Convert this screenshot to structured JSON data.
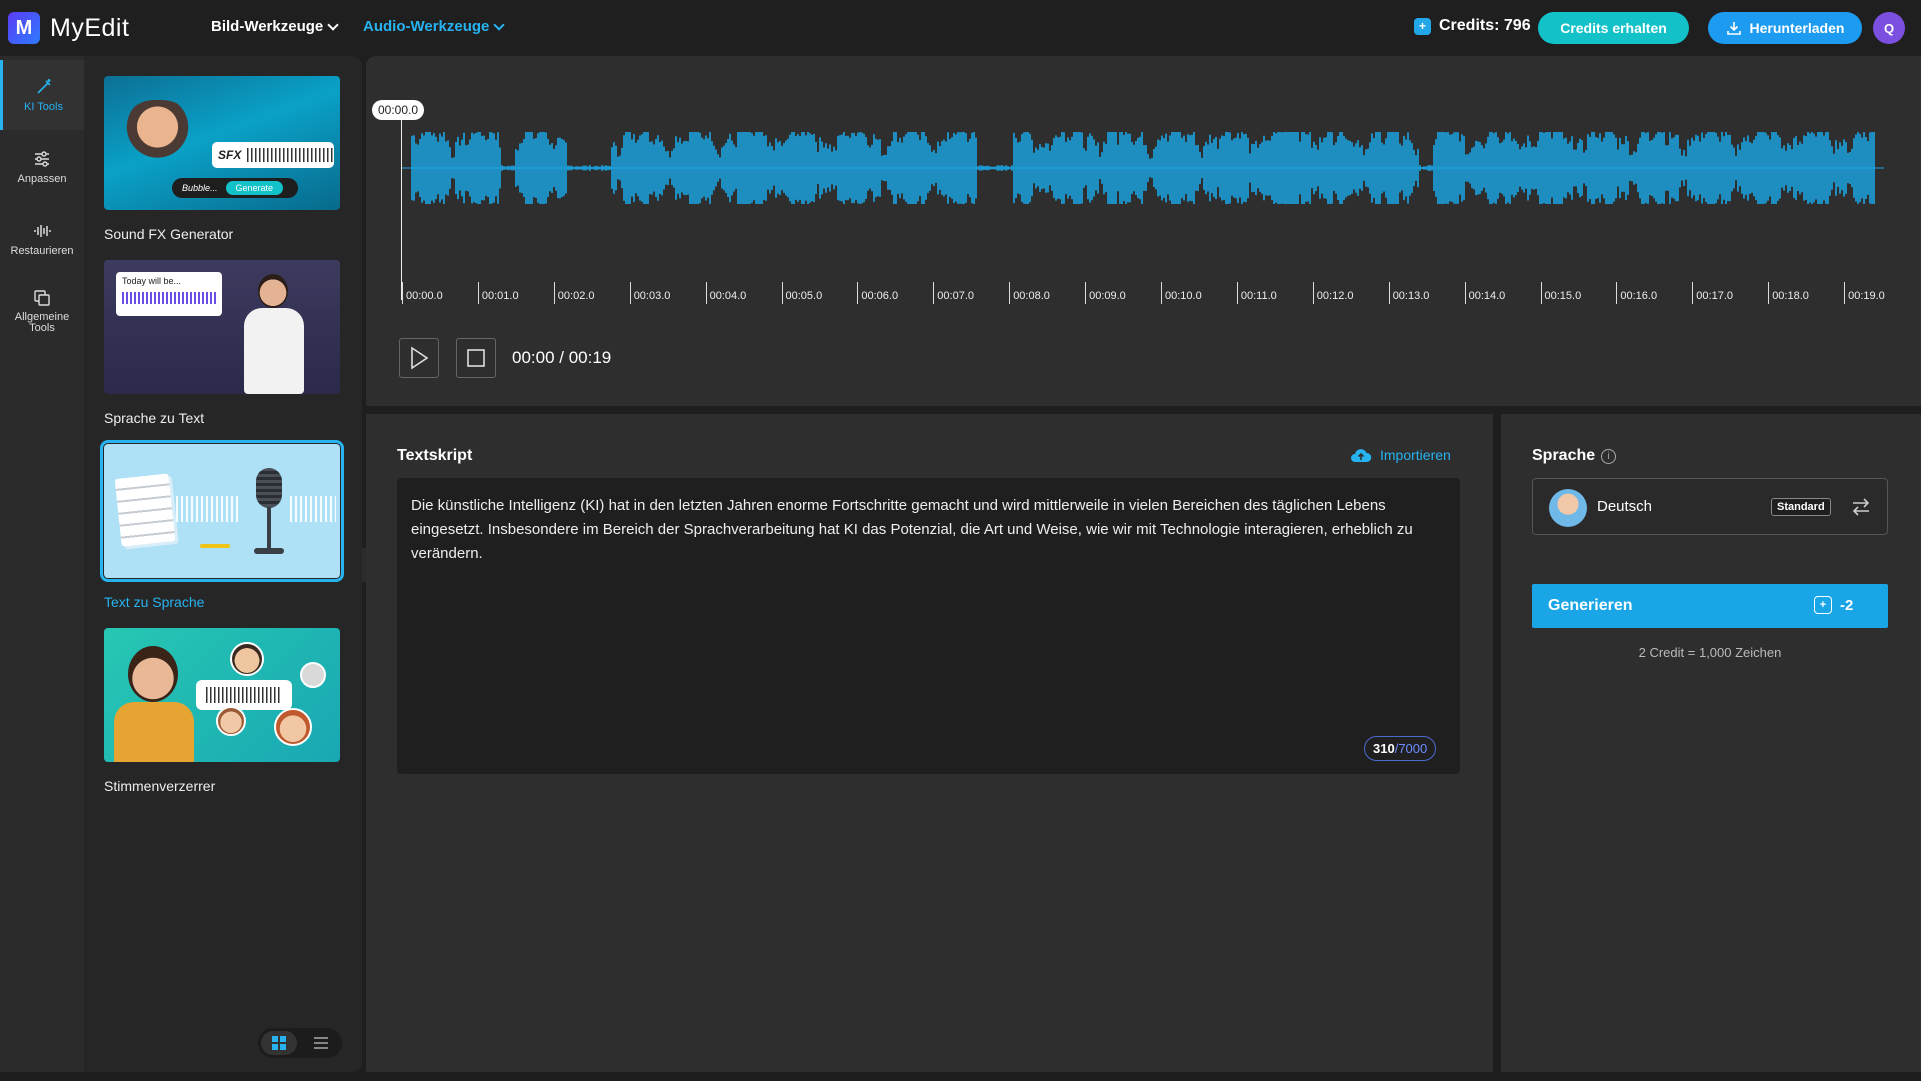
{
  "app": {
    "name": "MyEdit",
    "logo_letter": "M"
  },
  "nav": {
    "bild_label": "Bild-Werkzeuge",
    "audio_label": "Audio-Werkzeuge"
  },
  "header": {
    "credits_label": "Credits: 796",
    "get_credits_label": "Credits erhalten",
    "download_label": "Herunterladen",
    "avatar_letter": "Q"
  },
  "rail": {
    "items": [
      {
        "label": "KI Tools",
        "icon": "magic-wand-icon"
      },
      {
        "label": "Anpassen",
        "icon": "sliders-icon"
      },
      {
        "label": "Restaurieren",
        "icon": "waveform-icon"
      },
      {
        "label": "Allgemeine Tools",
        "icon": "copy-icon"
      }
    ]
  },
  "tools": {
    "items": [
      {
        "label": "Sound FX Generator",
        "sfx_text": "SFX",
        "bubble_text": "Bubble...",
        "generate_text": "Generate"
      },
      {
        "label": "Sprache zu Text",
        "caption_text": "Today will be..."
      },
      {
        "label": "Text zu Sprache"
      },
      {
        "label": "Stimmenverzerrer"
      }
    ]
  },
  "waveform": {
    "position_label": "00:00.0",
    "ticks": [
      "00:00.0",
      "00:01.0",
      "00:02.0",
      "00:03.0",
      "00:04.0",
      "00:05.0",
      "00:06.0",
      "00:07.0",
      "00:08.0",
      "00:09.0",
      "00:10.0",
      "00:11.0",
      "00:12.0",
      "00:13.0",
      "00:14.0",
      "00:15.0",
      "00:16.0",
      "00:17.0",
      "00:18.0",
      "00:19.0"
    ],
    "time_readout": "00:00 / 00:19",
    "color": "#1aa6e6"
  },
  "script": {
    "title": "Textskript",
    "import_label": "Importieren",
    "text": "Die künstliche Intelligenz (KI) hat in den letzten Jahren enorme Fortschritte gemacht und wird mittlerweile in vielen Bereichen des täglichen Lebens eingesetzt. Insbesondere im Bereich der Sprachverarbeitung hat KI das Potenzial, die Art und Weise, wie wir mit Technologie interagieren, erheblich zu verändern.",
    "count_current": "310",
    "count_max": "/7000"
  },
  "language": {
    "title": "Sprache",
    "name": "Deutsch",
    "badge": "Standard"
  },
  "generate": {
    "label": "Generieren",
    "cost": "-2",
    "note": "2 Credit = 1,000 Zeichen"
  },
  "colors": {
    "accent": "#27b3f0",
    "button_cyan": "#13c2c9",
    "button_blue": "#1d9bf0"
  }
}
